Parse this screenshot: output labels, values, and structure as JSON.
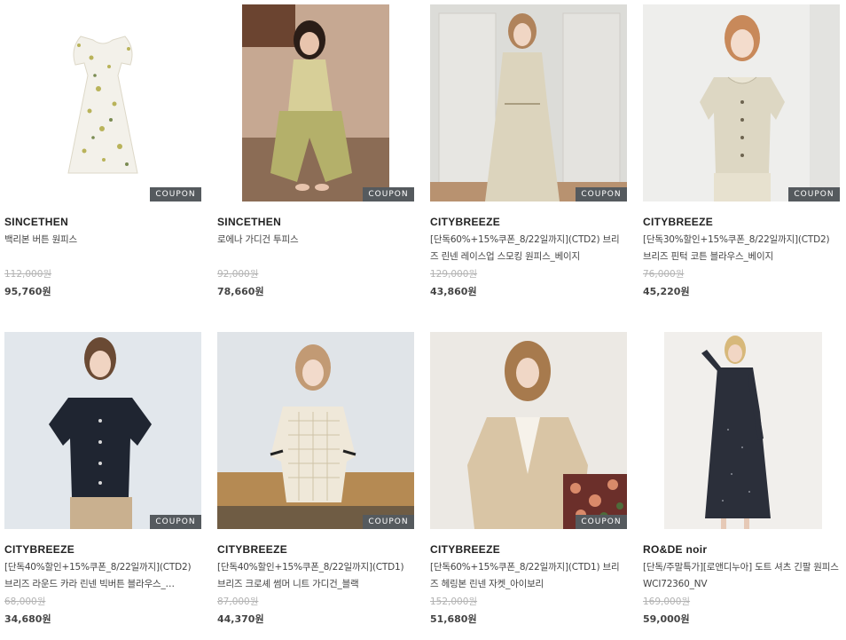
{
  "products": [
    {
      "brand": "SINCETHEN",
      "name": "백리본 버튼 원피스",
      "original_price": "112,000원",
      "sale_price": "95,760원",
      "coupon": "COUPON",
      "image": "white floral dress"
    },
    {
      "brand": "SINCETHEN",
      "name": "로에나 가디건 투피스",
      "original_price": "92,000원",
      "sale_price": "78,660원",
      "coupon": "COUPON",
      "image": "model in green knit two-piece"
    },
    {
      "brand": "CITYBREEZE",
      "name": "[단독60%+15%쿠폰_8/22일까지](CTD2) 브리즈 린넨 레이스업 스모킹 원피스_베이지",
      "original_price": "129,000원",
      "sale_price": "43,860원",
      "coupon": "COUPON",
      "image": "model in beige linen dress"
    },
    {
      "brand": "CITYBREEZE",
      "name": "[단독30%할인+15%쿠폰_8/22일까지](CTD2) 브리즈 핀턱 코튼 블라우스_베이지",
      "original_price": "76,000원",
      "sale_price": "45,220원",
      "coupon": "COUPON",
      "image": "model in beige blouse"
    },
    {
      "brand": "CITYBREEZE",
      "name": "[단독40%할인+15%쿠폰_8/22일까지](CTD2) 브리즈 라운드 카라 린넨 빅버튼 블라우스_…",
      "original_price": "68,000원",
      "sale_price": "34,680원",
      "coupon": "COUPON",
      "image": "model in black linen blouse"
    },
    {
      "brand": "CITYBREEZE",
      "name": "[단독40%할인+15%쿠폰_8/22일까지](CTD1) 브리즈 크로셰 썸머 니트 가디건_블랙",
      "original_price": "87,000원",
      "sale_price": "44,370원",
      "coupon": "COUPON",
      "image": "model in crochet knit cardigan"
    },
    {
      "brand": "CITYBREEZE",
      "name": "[단독60%+15%쿠폰_8/22일까지](CTD1) 브리즈 헤링본 린넨 자켓_아이보리",
      "original_price": "152,000원",
      "sale_price": "51,680원",
      "coupon": "COUPON",
      "image": "model in beige linen jacket"
    },
    {
      "brand": "RO&DE noir",
      "name": "[단독/주말특가][로앤디누아] 도트 셔츠 긴팔 원피스 WCI72360_NV",
      "original_price": "169,000원",
      "sale_price": "59,000원",
      "coupon": "",
      "image": "model in navy dot shirt dress"
    }
  ]
}
